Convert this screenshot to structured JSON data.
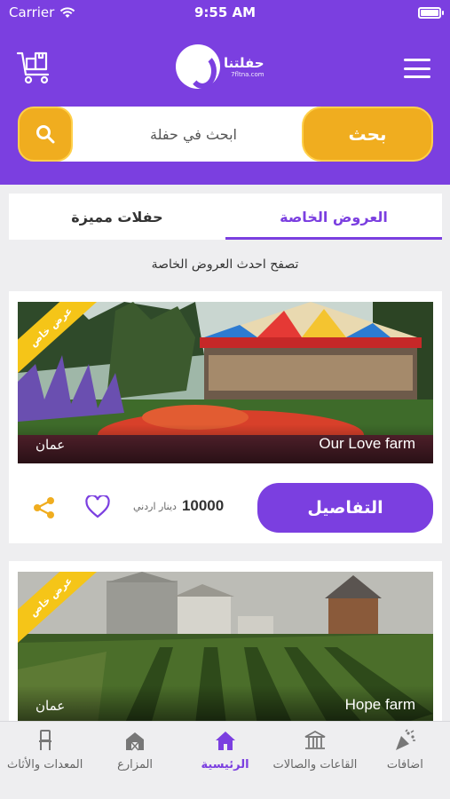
{
  "status_bar": {
    "carrier": "Carrier",
    "time": "9:55 AM"
  },
  "header": {
    "logo_text": "حفلتنا",
    "logo_domain": "7fltna.com",
    "search": {
      "placeholder": "ابحث في حفلة",
      "button_label": "بحث"
    }
  },
  "tabs": [
    {
      "label": "العروض الخاصة",
      "active": true
    },
    {
      "label": "حفلات مميزة",
      "active": false
    }
  ],
  "section_subtitle": "تصفح احدث العروض الخاصة",
  "listings": [
    {
      "badge": "عرض خاص",
      "name": "Our Love farm",
      "city": "عمان",
      "price": "10000",
      "currency": "دينار اردني",
      "details_label": "التفاصيل"
    },
    {
      "badge": "عرض خاص",
      "name": "Hope farm",
      "city": "عمان"
    }
  ],
  "bottom_nav": [
    {
      "label": "اضافات",
      "icon": "party-popper-icon",
      "active": false
    },
    {
      "label": "القاعات والصالات",
      "icon": "hall-icon",
      "active": false
    },
    {
      "label": "الرئيسية",
      "icon": "home-icon",
      "active": true
    },
    {
      "label": "المزارع",
      "icon": "farm-icon",
      "active": false
    },
    {
      "label": "المعدات والأثاث",
      "icon": "chair-icon",
      "active": false
    }
  ],
  "colors": {
    "primary": "#7b3fe0",
    "accent": "#f0ad1f",
    "badge": "#f5c518"
  }
}
